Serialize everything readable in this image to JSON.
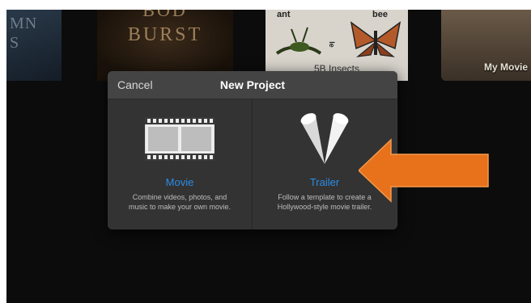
{
  "background": {
    "thumb1_text": "MN\nS",
    "thumb2_top": "BOD",
    "thumb2_bottom": "BURST",
    "thumb3_word1": "ant",
    "thumb3_word2": "bee",
    "thumb3_side": "le",
    "thumb3_caption": "5B Insects",
    "thumb4_label": "My Movie"
  },
  "dialog": {
    "cancel_label": "Cancel",
    "title": "New Project",
    "movie": {
      "label": "Movie",
      "description_line1": "Combine videos, photos, and",
      "description_line2": "music to make your own movie."
    },
    "trailer": {
      "label": "Trailer",
      "description_line1": "Follow a template to create a",
      "description_line2": "Hollywood-style movie trailer."
    }
  },
  "colors": {
    "accent_blue": "#2b8ce6",
    "arrow_orange": "#e8711c"
  }
}
